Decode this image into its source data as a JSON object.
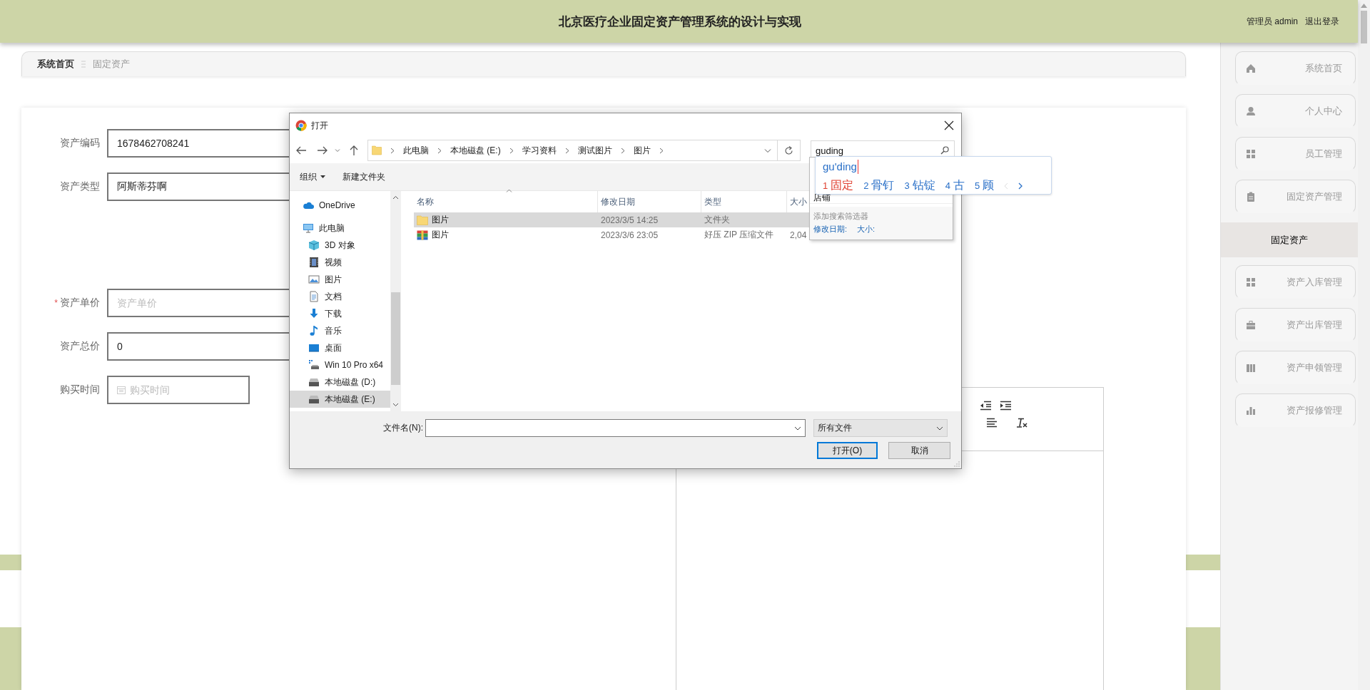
{
  "header": {
    "title": "北京医疗企业固定资产管理系统的设计与实现",
    "user": "管理员 admin",
    "logout": "退出登录"
  },
  "breadcrumb": [
    {
      "label": "系统首页",
      "selected": false
    },
    {
      "label": "固定资产",
      "selected": true
    }
  ],
  "sidebar": {
    "items": [
      {
        "label": "系统首页",
        "kind": "menu",
        "selected": false
      },
      {
        "label": "个人中心",
        "kind": "menu",
        "selected": false
      },
      {
        "label": "员工管理",
        "kind": "menu",
        "selected": false
      },
      {
        "label": "固定资产管理",
        "kind": "menu",
        "selected": false
      },
      {
        "label": "固定资产",
        "kind": "submenu",
        "selected": true
      },
      {
        "label": "资产入库管理",
        "kind": "menu",
        "selected": false
      },
      {
        "label": "资产出库管理",
        "kind": "menu",
        "selected": false
      },
      {
        "label": "资产申领管理",
        "kind": "menu",
        "selected": false
      },
      {
        "label": "资产报修管理",
        "kind": "menu",
        "selected": false
      }
    ]
  },
  "form": {
    "fields": [
      {
        "label": "资产编码",
        "kind": "text",
        "value": "1678462708241"
      },
      {
        "label": "资产类型",
        "kind": "text",
        "value": "阿斯蒂芬啊"
      },
      {
        "label": "资产单价",
        "kind": "text",
        "placeholder": "资产单价",
        "required_mark": "*"
      },
      {
        "label": "资产总价",
        "kind": "text",
        "value": "0"
      },
      {
        "label": "购买时间",
        "kind": "date",
        "placeholder": "购买时间"
      }
    ]
  },
  "file_dialog": {
    "title": "打开",
    "path": [
      "此电脑",
      "本地磁盘 (E:)",
      "学习资料",
      "测试图片",
      "图片"
    ],
    "search": {
      "value": "guding"
    },
    "toolbar": [
      "组织",
      "新建文件夹"
    ],
    "nav": [
      {
        "label": "OneDrive",
        "selected": false
      },
      {
        "label": "此电脑",
        "selected": false,
        "children": [
          {
            "label": "3D 对象",
            "selected": false
          },
          {
            "label": "视频",
            "selected": false
          },
          {
            "label": "图片",
            "selected": false
          },
          {
            "label": "文档",
            "selected": false
          },
          {
            "label": "下载",
            "selected": false
          },
          {
            "label": "音乐",
            "selected": false
          },
          {
            "label": "桌面",
            "selected": false
          },
          {
            "label": "Win 10 Pro x64",
            "selected": false
          },
          {
            "label": "本地磁盘 (D:)",
            "selected": false
          },
          {
            "label": "本地磁盘 (E:)",
            "selected": true
          }
        ]
      }
    ],
    "columns": [
      "名称",
      "修改日期",
      "类型",
      "大小"
    ],
    "files": [
      {
        "name": "图片",
        "kind": "folder",
        "modified": "2023/3/5 14:25",
        "type": "文件夹",
        "selected": true
      },
      {
        "name": "图片",
        "kind": "zip",
        "modified": "2023/3/6 23:05",
        "type": "好压 ZIP 压缩文件",
        "size": "2,04",
        "selected": false
      }
    ],
    "filename_label": "文件名(N):",
    "filter": "所有文件",
    "buttons": [
      {
        "label": "打开(O)",
        "default": true
      },
      {
        "label": "取消",
        "default": false
      }
    ]
  },
  "search_suggestions": {
    "items": [
      "店铺"
    ],
    "filter_hint": "添加搜索筛选器",
    "filters": [
      "修改日期:",
      "大小:"
    ]
  },
  "ime": {
    "composition": "gu'ding",
    "candidates": [
      {
        "index": "1",
        "text": "固定",
        "selected": true
      },
      {
        "index": "2",
        "text": "骨钉",
        "selected": false
      },
      {
        "index": "3",
        "text": "钻锭",
        "selected": false
      },
      {
        "index": "4",
        "text": "古",
        "selected": false
      },
      {
        "index": "5",
        "text": "顾",
        "selected": false
      }
    ]
  }
}
